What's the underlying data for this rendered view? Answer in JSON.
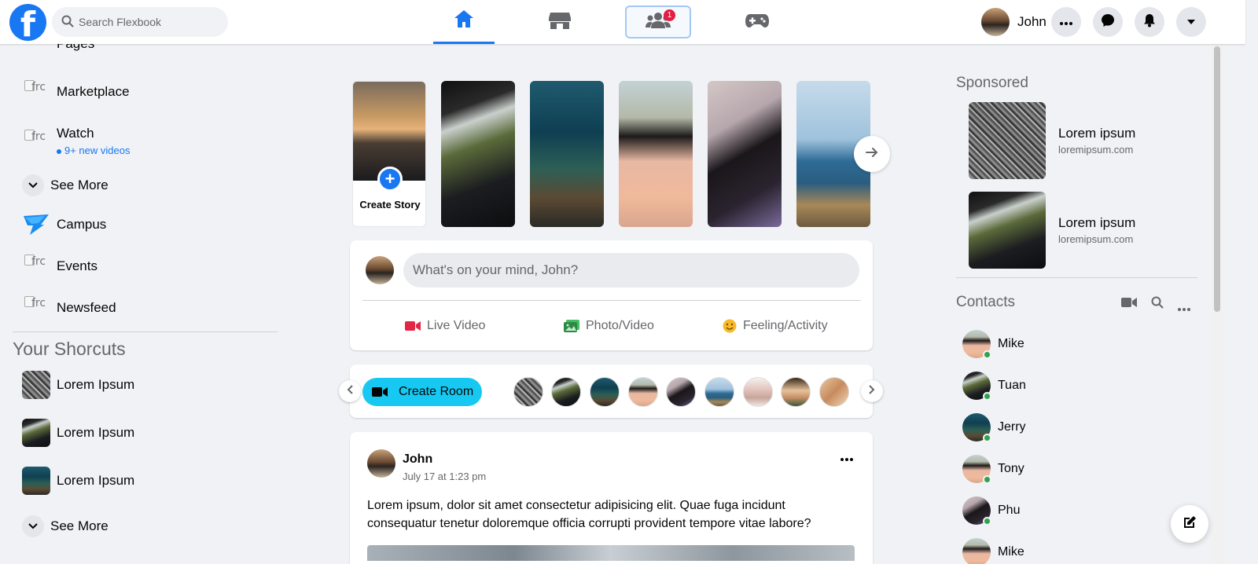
{
  "header": {
    "logo_letter": "f",
    "search_placeholder": "Search Flexbook",
    "nav_tabs": [
      "home",
      "marketplace",
      "groups",
      "gaming"
    ],
    "groups_badge": "1",
    "user_name": "John",
    "accent_color": "#1877f2"
  },
  "left_sidebar": {
    "items": [
      {
        "label": "Pages"
      },
      {
        "label": "Marketplace"
      },
      {
        "label": "Watch",
        "note": "9+ new videos"
      },
      {
        "label": "See More"
      },
      {
        "label": "Campus"
      },
      {
        "label": "Events"
      },
      {
        "label": "Newsfeed"
      }
    ],
    "broken_image_alt": "frc",
    "shortcuts_title": "Your Shorcuts",
    "shortcuts": [
      {
        "label": "Lorem Ipsum"
      },
      {
        "label": "Lorem Ipsum"
      },
      {
        "label": "Lorem Ipsum"
      }
    ],
    "shortcuts_see_more": "See More"
  },
  "stories": {
    "create_label": "Create Story",
    "count": 5
  },
  "composer": {
    "placeholder": "What's on your mind, John?",
    "actions": [
      {
        "label": "Live Video",
        "color": "#e42645"
      },
      {
        "label": "Photo/Video",
        "color": "#45bd62"
      },
      {
        "label": "Feeling/Activity",
        "color": "#f7b928"
      }
    ]
  },
  "rooms": {
    "create_label": "Create Room",
    "room_button_color": "#17c9f2"
  },
  "post": {
    "author": "John",
    "time": "July 17 at 1:23 pm",
    "text": "Lorem ipsum, dolor sit amet consectetur adipisicing elit. Quae fuga incidunt consequatur tenetur doloremque officia corrupti provident tempore vitae labore?"
  },
  "sponsored": {
    "title": "Sponsored",
    "items": [
      {
        "name": "Lorem ipsum",
        "url": "loremipsum.com"
      },
      {
        "name": "Lorem ipsum",
        "url": "loremipsum.com"
      }
    ]
  },
  "contacts": {
    "title": "Contacts",
    "people": [
      {
        "name": "Mike"
      },
      {
        "name": "Tuan"
      },
      {
        "name": "Jerry"
      },
      {
        "name": "Tony"
      },
      {
        "name": "Phu"
      },
      {
        "name": "Mike"
      }
    ],
    "online_color": "#31a24c"
  }
}
